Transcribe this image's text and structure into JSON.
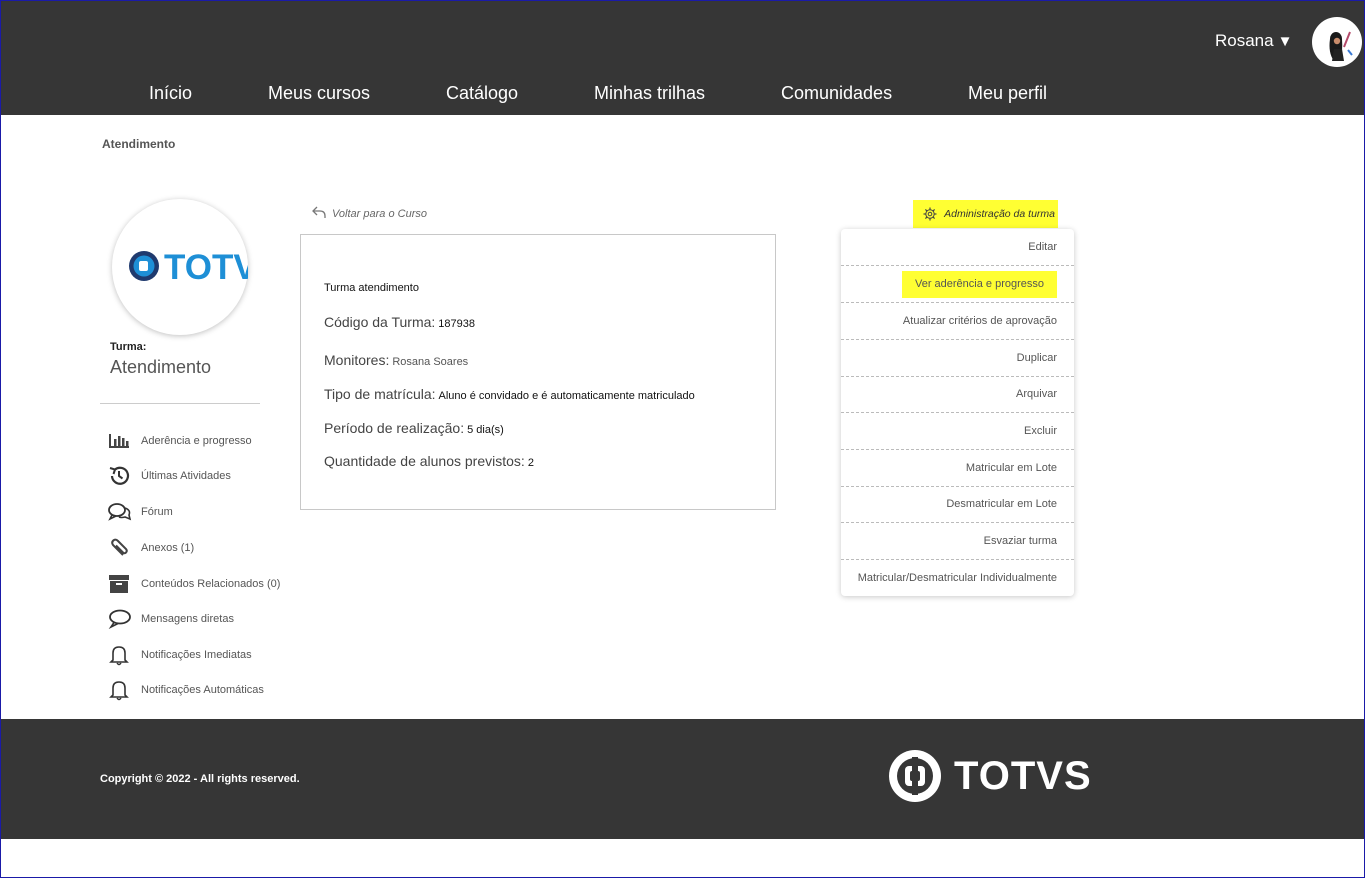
{
  "header": {
    "user_name": "Rosana",
    "caret": "▼",
    "nav": [
      "Início",
      "Meus cursos",
      "Catálogo",
      "Minhas trilhas",
      "Comunidades",
      "Meu perfil"
    ]
  },
  "breadcrumb": "Atendimento",
  "course": {
    "logo_text": "TOTVS",
    "turma_label": "Turma:",
    "turma_name": "Atendimento"
  },
  "sidebar": {
    "items": [
      {
        "label": "Aderência e progresso",
        "icon": "bar-chart-icon"
      },
      {
        "label": "Últimas Atividades",
        "icon": "history-icon"
      },
      {
        "label": "Fórum",
        "icon": "comments-icon"
      },
      {
        "label": "Anexos (1)",
        "icon": "paperclip-icon"
      },
      {
        "label": "Conteúdos Relacionados (0)",
        "icon": "archive-box-icon"
      },
      {
        "label": "Mensagens diretas",
        "icon": "chat-bubble-icon"
      },
      {
        "label": "Notificações Imediatas",
        "icon": "bell-icon"
      },
      {
        "label": "Notificações Automáticas",
        "icon": "bell-icon"
      }
    ]
  },
  "card": {
    "back_link": "Voltar para o Curso",
    "title": "Turma atendimento",
    "rows": [
      {
        "label": "Código da Turma:",
        "value": "187938"
      },
      {
        "label": "Monitores:",
        "value": "Rosana Soares"
      },
      {
        "label": "Tipo de matrícula:",
        "value": "Aluno é convidado e é automaticamente matriculado"
      },
      {
        "label": "Período de realização:",
        "value": "5 dia(s)"
      },
      {
        "label": "Quantidade de alunos previstos:",
        "value": "2"
      }
    ]
  },
  "admin": {
    "toggle_label": "Administração da turma",
    "items": [
      "Editar",
      "Ver aderência e progresso",
      "Atualizar critérios de aprovação",
      "Duplicar",
      "Arquivar",
      "Excluir",
      "Matricular em Lote",
      "Desmatricular em Lote",
      "Esvaziar turma",
      "Matricular/Desmatricular Individualmente"
    ],
    "highlight_color": "#ffff33"
  },
  "footer": {
    "copyright": "Copyright © 2022 - All rights reserved.",
    "logo_text": "TOTVS"
  },
  "colors": {
    "header_bg": "#363636",
    "brand_blue": "#1e8fd6",
    "brand_navy": "#1f3a6e"
  }
}
